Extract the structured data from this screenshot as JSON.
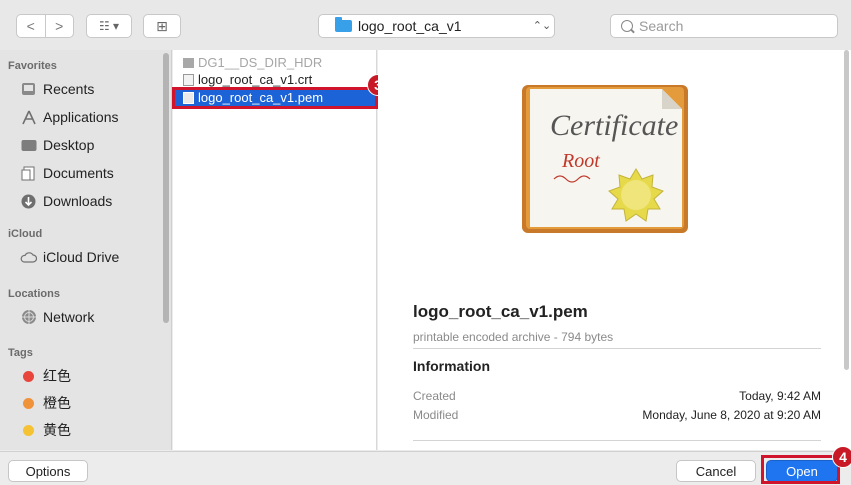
{
  "toolbar": {
    "back_glyph": "<",
    "forward_glyph": ">",
    "view_glyph": "☷ ▾",
    "newfolder_glyph": "⊞",
    "path_label": "logo_root_ca_v1",
    "updown_glyph": "⌃⌄",
    "search_placeholder": "Search"
  },
  "sidebar": {
    "favorites_label": "Favorites",
    "favorites": [
      {
        "label": "Recents",
        "icon": "recents-icon"
      },
      {
        "label": "Applications",
        "icon": "applications-icon"
      },
      {
        "label": "Desktop",
        "icon": "desktop-icon"
      },
      {
        "label": "Documents",
        "icon": "documents-icon"
      },
      {
        "label": "Downloads",
        "icon": "downloads-icon"
      }
    ],
    "icloud_label": "iCloud",
    "icloud": [
      {
        "label": "iCloud Drive",
        "icon": "cloud-icon"
      }
    ],
    "locations_label": "Locations",
    "locations": [
      {
        "label": "Network",
        "icon": "network-icon"
      }
    ],
    "tags_label": "Tags",
    "tags": [
      {
        "label": "红色",
        "color": "#e8453c"
      },
      {
        "label": "橙色",
        "color": "#f0923a"
      },
      {
        "label": "黄色",
        "color": "#f4c232"
      }
    ]
  },
  "files": [
    {
      "name": "DG1__DS_DIR_HDR",
      "state": "dim",
      "icon": "folder-icon"
    },
    {
      "name": "logo_root_ca_v1.crt",
      "state": "normal",
      "icon": "certificate-file-icon"
    },
    {
      "name": "logo_root_ca_v1.pem",
      "state": "selected",
      "icon": "certificate-file-icon"
    }
  ],
  "annotations": {
    "step3": "3",
    "step4": "4"
  },
  "preview": {
    "cert_word": "Certificate",
    "cert_sub": "Root",
    "filename": "logo_root_ca_v1.pem",
    "kind": "printable encoded archive - 794 bytes",
    "info_heading": "Information",
    "created_label": "Created",
    "created_value": "Today, 9:42 AM",
    "modified_label": "Modified",
    "modified_value": "Monday, June 8, 2020 at 9:20 AM"
  },
  "resize_glyph": "||",
  "buttons": {
    "options": "Options",
    "cancel": "Cancel",
    "open": "Open"
  },
  "colors": {
    "accent": "#1f74f0",
    "selection": "#1d63d8",
    "annotation": "#d0142c"
  }
}
